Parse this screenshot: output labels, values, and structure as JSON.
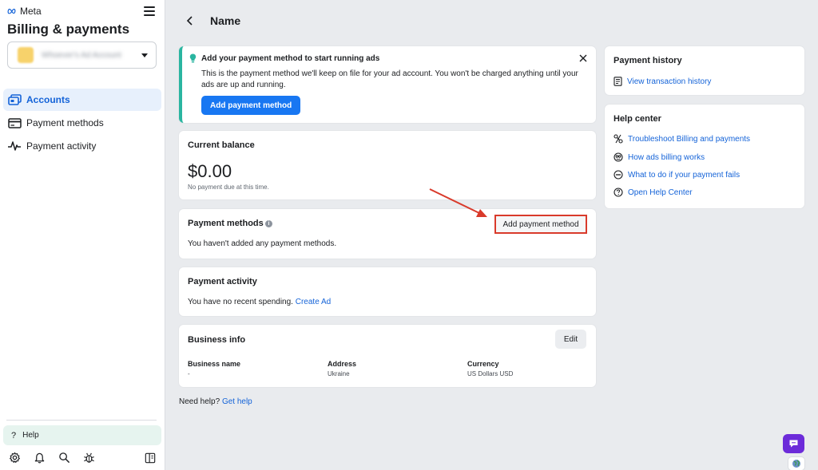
{
  "sidebar": {
    "brand": "Meta",
    "title": "Billing & payments",
    "account_name": "Whoever's Ad Account",
    "items": [
      {
        "label": "Accounts",
        "icon": "accounts-icon"
      },
      {
        "label": "Payment methods",
        "icon": "credit-card-icon"
      },
      {
        "label": "Payment activity",
        "icon": "activity-pulse-icon"
      }
    ],
    "help_label": "Help"
  },
  "header": {
    "title": "Name"
  },
  "notice": {
    "title": "Add your payment method to start running ads",
    "body": "This is the payment method we'll keep on file for your ad account. You won't be charged anything until your ads are up and running.",
    "button": "Add payment method"
  },
  "balance": {
    "title": "Current balance",
    "amount": "$0.00",
    "sub": "No payment due at this time."
  },
  "payment_methods": {
    "title": "Payment methods",
    "empty": "You haven't added any payment methods.",
    "add_button": "Add payment method"
  },
  "payment_activity": {
    "title": "Payment activity",
    "empty": "You have no recent spending.",
    "link": "Create Ad"
  },
  "business_info": {
    "title": "Business info",
    "edit": "Edit",
    "columns": [
      {
        "header": "Business name",
        "value": "-"
      },
      {
        "header": "Address",
        "value": "Ukraine"
      },
      {
        "header": "Currency",
        "value": "US Dollars USD"
      }
    ]
  },
  "need_help": {
    "text": "Need help?",
    "link": "Get help"
  },
  "payment_history": {
    "title": "Payment history",
    "link": "View transaction history"
  },
  "help_center": {
    "title": "Help center",
    "links": [
      {
        "label": "Troubleshoot Billing and payments",
        "icon": "tools-icon"
      },
      {
        "label": "How ads billing works",
        "icon": "billing-info-icon"
      },
      {
        "label": "What to do if your payment fails",
        "icon": "minus-circle-icon"
      },
      {
        "label": "Open Help Center",
        "icon": "question-circle-icon"
      }
    ]
  },
  "colors": {
    "primary": "#1877f2",
    "link": "#1463d8",
    "accent_teal": "#2ab5a0",
    "highlight_red": "#d93a2b",
    "chat_purple": "#6c2bd9"
  }
}
